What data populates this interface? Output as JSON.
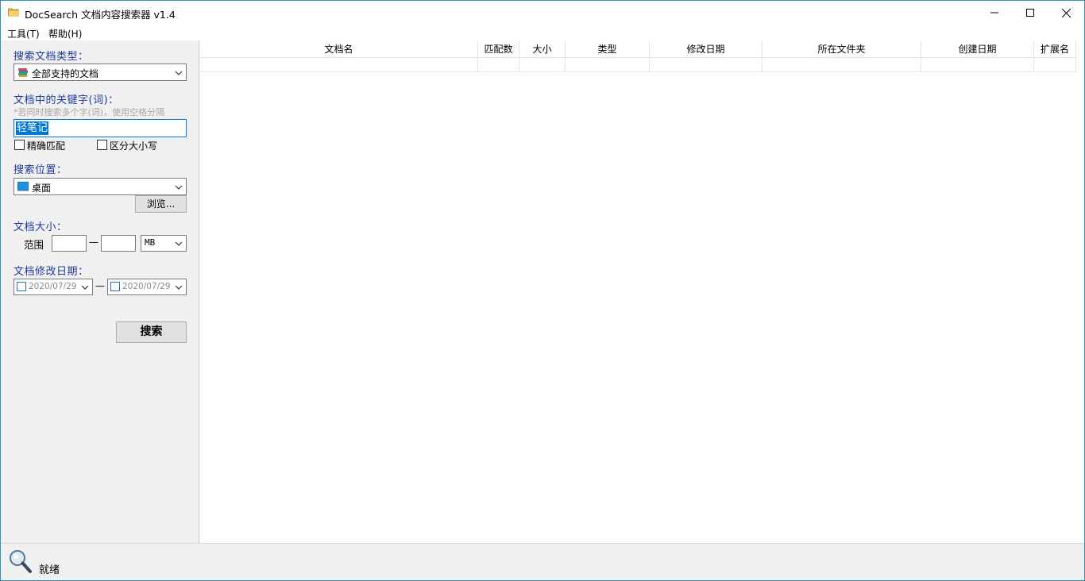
{
  "window": {
    "title": "DocSearch 文档内容搜索器 v1.4"
  },
  "menu": {
    "tools": "工具(T)",
    "help": "帮助(H)"
  },
  "search_type": {
    "label": "搜索文档类型：",
    "value": "全部支持的文档",
    "icon": "books-icon"
  },
  "keywords": {
    "label": "文档中的关键字(词)：",
    "hint": "*若同时搜索多个字(词)，使用空格分隔",
    "value": "轻笔记"
  },
  "options": {
    "exact_match": "精确匹配",
    "case_sensitive": "区分大小写"
  },
  "location": {
    "label": "搜索位置：",
    "value": "桌面",
    "icon": "desktop-icon",
    "browse": "浏览..."
  },
  "size": {
    "label": "文档大小：",
    "range_label": "范围",
    "min": "",
    "max": "",
    "separator": "—",
    "unit": "MB"
  },
  "modified": {
    "label": "文档修改日期：",
    "from": "2020/07/29",
    "to": "2020/07/29",
    "separator": "—"
  },
  "search_button": "搜索",
  "table": {
    "columns": [
      "文档名",
      "匹配数",
      "大小",
      "类型",
      "修改日期",
      "所在文件夹",
      "创建日期",
      "扩展名"
    ]
  },
  "status": {
    "text": "就绪",
    "icon": "magnifier-icon"
  },
  "colors": {
    "label_blue": "#1e3b9e",
    "selection": "#0078d7",
    "window_border": "#2b93b8"
  }
}
